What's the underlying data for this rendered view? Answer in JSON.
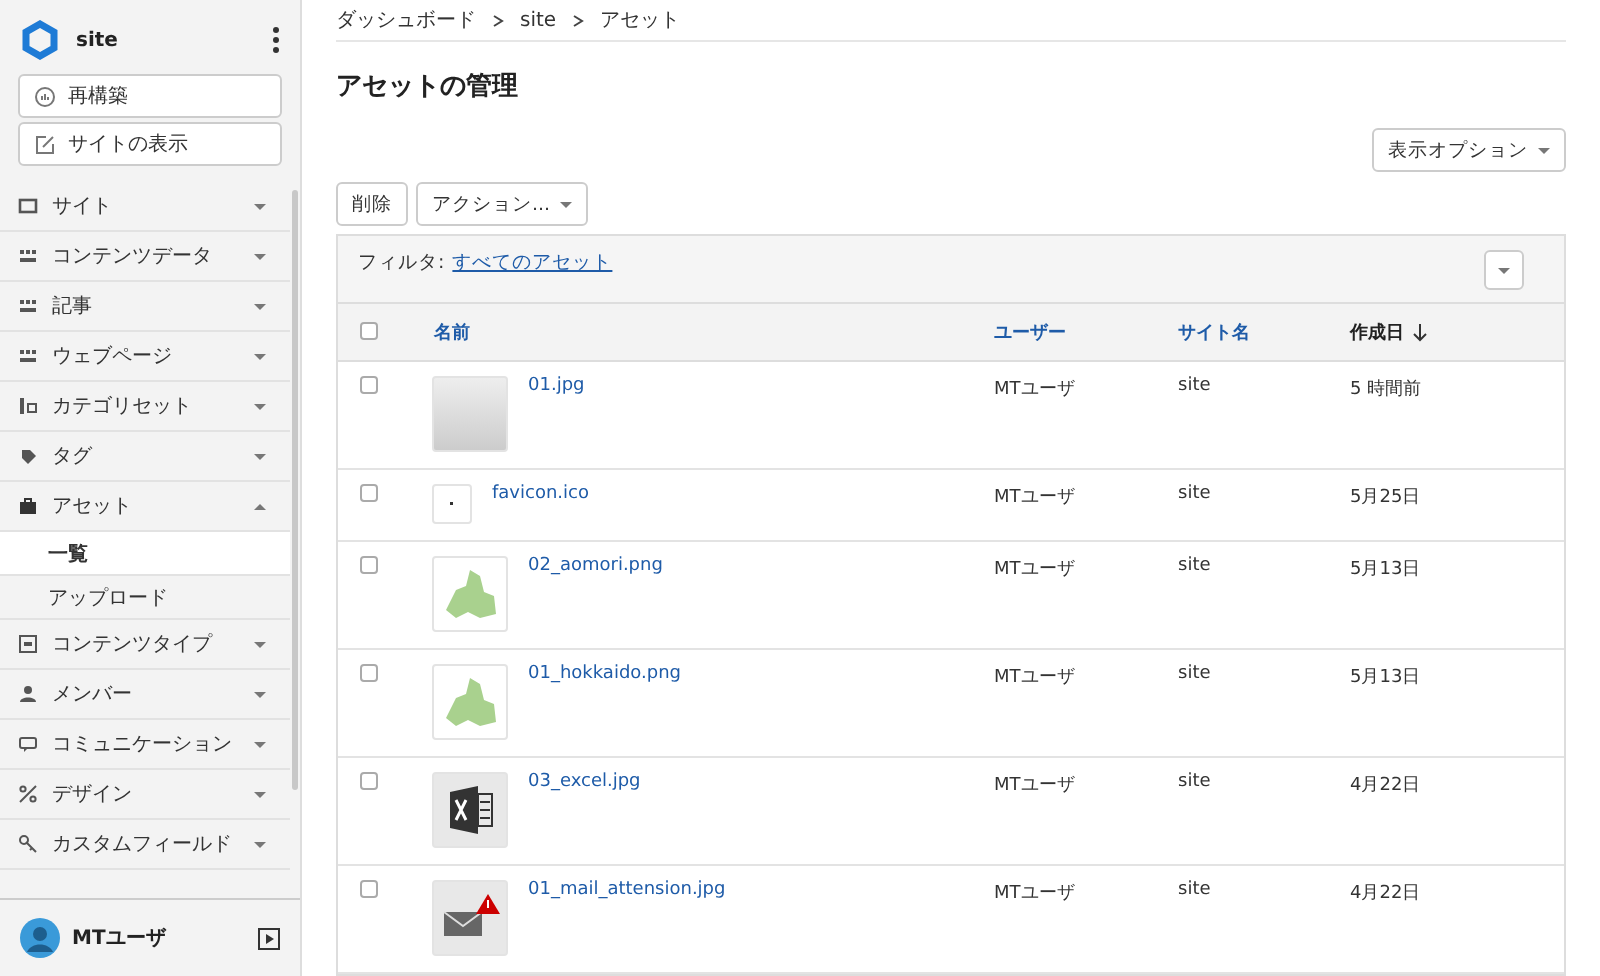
{
  "sidebar": {
    "site_name": "site",
    "actions": [
      {
        "label": "再構築",
        "kind": "rebuild"
      },
      {
        "label": "サイトの表示",
        "kind": "view"
      }
    ],
    "items": [
      {
        "label": "サイト",
        "kind": "site",
        "expanded": false
      },
      {
        "label": "コンテンツデータ",
        "kind": "data",
        "expanded": false
      },
      {
        "label": "記事",
        "kind": "data",
        "expanded": false
      },
      {
        "label": "ウェブページ",
        "kind": "data",
        "expanded": false
      },
      {
        "label": "カテゴリセット",
        "kind": "category",
        "expanded": false
      },
      {
        "label": "タグ",
        "kind": "tag",
        "expanded": false
      },
      {
        "label": "アセット",
        "kind": "asset",
        "expanded": true,
        "children": [
          {
            "label": "一覧",
            "selected": true
          },
          {
            "label": "アップロード",
            "selected": false
          }
        ]
      },
      {
        "label": "コンテンツタイプ",
        "kind": "type",
        "expanded": false
      },
      {
        "label": "メンバー",
        "kind": "member",
        "expanded": false
      },
      {
        "label": "コミュニケーション",
        "kind": "comment",
        "expanded": false
      },
      {
        "label": "デザイン",
        "kind": "design",
        "expanded": false
      },
      {
        "label": "カスタムフィールド",
        "kind": "field",
        "expanded": false
      }
    ],
    "user": "MTユーザ"
  },
  "breadcrumb": [
    "ダッシュボード",
    "site",
    "アセット"
  ],
  "title": "アセットの管理",
  "display_options": "表示オプション",
  "buttons": [
    "削除",
    "アクション..."
  ],
  "filter": {
    "label": "フィルタ:",
    "value": "すべてのアセット"
  },
  "table": {
    "select_all_checked": false,
    "columns": [
      {
        "label": "名前",
        "sorted": false
      },
      {
        "label": "ユーザー",
        "sorted": false
      },
      {
        "label": "サイト名",
        "sorted": false
      },
      {
        "label": "作成日",
        "sorted": true
      }
    ],
    "rows": [
      {
        "checked": false,
        "kind": "photo",
        "name": "01.jpg",
        "user": "MTユーザ",
        "site": "site",
        "date": "5 時間前"
      },
      {
        "checked": false,
        "kind": "small",
        "name": "favicon.ico",
        "user": "MTユーザ",
        "site": "site",
        "date": "5月25日"
      },
      {
        "checked": false,
        "kind": "map",
        "name": "02_aomori.png",
        "user": "MTユーザ",
        "site": "site",
        "date": "5月13日"
      },
      {
        "checked": false,
        "kind": "map",
        "name": "01_hokkaido.png",
        "user": "MTユーザ",
        "site": "site",
        "date": "5月13日"
      },
      {
        "checked": false,
        "kind": "spreadsheet",
        "name": "03_excel.jpg",
        "user": "MTユーザ",
        "site": "site",
        "date": "4月22日"
      },
      {
        "checked": false,
        "kind": "mail",
        "name": "01_mail_attension.jpg",
        "user": "MTユーザ",
        "site": "site",
        "date": "4月22日"
      }
    ]
  }
}
